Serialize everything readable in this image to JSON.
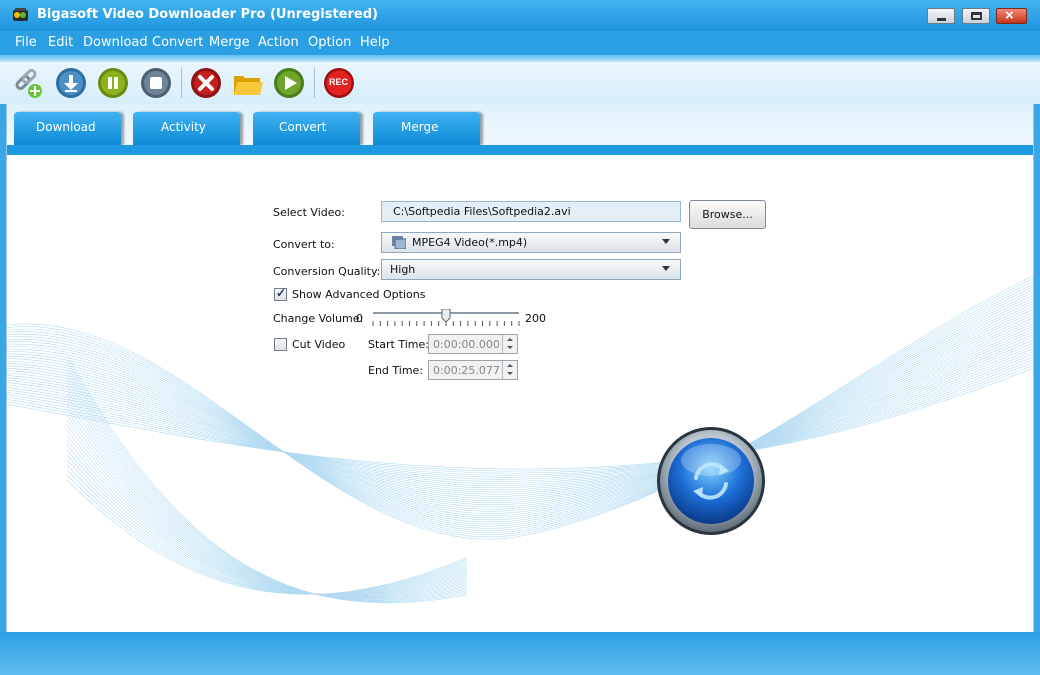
{
  "window": {
    "title": "Bigasoft Video Downloader Pro (Unregistered)"
  },
  "menu": [
    "File",
    "Edit",
    "Download",
    "Convert",
    "Merge",
    "Action",
    "Option",
    "Help"
  ],
  "toolbar": {
    "icons": [
      "link-add-icon",
      "download-icon",
      "pause-icon",
      "stop-icon",
      "delete-icon",
      "folder-icon",
      "play-icon",
      "record-icon"
    ],
    "rec_label": "REC"
  },
  "tabs": [
    "Download",
    "Activity",
    "Convert",
    "Merge"
  ],
  "form": {
    "select_video_label": "Select Video:",
    "select_video_value": "C:\\Softpedia Files\\Softpedia2.avi",
    "browse_label": "Browse...",
    "convert_to_label": "Convert to:",
    "convert_to_value": "MPEG4 Video(*.mp4)",
    "quality_label": "Conversion Quality:",
    "quality_value": "High",
    "show_advanced_label": "Show Advanced Options",
    "show_advanced_checked": true,
    "volume_label": "Change Volume:",
    "volume_min": "0",
    "volume_max": "200",
    "volume_value": 100,
    "cut_video_label": "Cut Video",
    "cut_video_checked": false,
    "start_time_label": "Start Time:",
    "start_time_value": "0:00:00.000",
    "end_time_label": "End Time:",
    "end_time_value": "0:00:25.077"
  },
  "colors": {
    "accent": "#1e9ae0",
    "title_bar": "#2b9fe3"
  }
}
